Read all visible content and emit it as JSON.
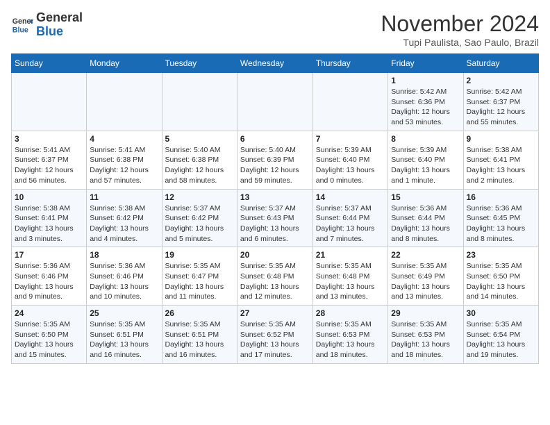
{
  "header": {
    "logo_general": "General",
    "logo_blue": "Blue",
    "title": "November 2024",
    "subtitle": "Tupi Paulista, Sao Paulo, Brazil"
  },
  "days_of_week": [
    "Sunday",
    "Monday",
    "Tuesday",
    "Wednesday",
    "Thursday",
    "Friday",
    "Saturday"
  ],
  "weeks": [
    [
      {
        "day": "",
        "info": ""
      },
      {
        "day": "",
        "info": ""
      },
      {
        "day": "",
        "info": ""
      },
      {
        "day": "",
        "info": ""
      },
      {
        "day": "",
        "info": ""
      },
      {
        "day": "1",
        "info": "Sunrise: 5:42 AM\nSunset: 6:36 PM\nDaylight: 12 hours and 53 minutes."
      },
      {
        "day": "2",
        "info": "Sunrise: 5:42 AM\nSunset: 6:37 PM\nDaylight: 12 hours and 55 minutes."
      }
    ],
    [
      {
        "day": "3",
        "info": "Sunrise: 5:41 AM\nSunset: 6:37 PM\nDaylight: 12 hours and 56 minutes."
      },
      {
        "day": "4",
        "info": "Sunrise: 5:41 AM\nSunset: 6:38 PM\nDaylight: 12 hours and 57 minutes."
      },
      {
        "day": "5",
        "info": "Sunrise: 5:40 AM\nSunset: 6:38 PM\nDaylight: 12 hours and 58 minutes."
      },
      {
        "day": "6",
        "info": "Sunrise: 5:40 AM\nSunset: 6:39 PM\nDaylight: 12 hours and 59 minutes."
      },
      {
        "day": "7",
        "info": "Sunrise: 5:39 AM\nSunset: 6:40 PM\nDaylight: 13 hours and 0 minutes."
      },
      {
        "day": "8",
        "info": "Sunrise: 5:39 AM\nSunset: 6:40 PM\nDaylight: 13 hours and 1 minute."
      },
      {
        "day": "9",
        "info": "Sunrise: 5:38 AM\nSunset: 6:41 PM\nDaylight: 13 hours and 2 minutes."
      }
    ],
    [
      {
        "day": "10",
        "info": "Sunrise: 5:38 AM\nSunset: 6:41 PM\nDaylight: 13 hours and 3 minutes."
      },
      {
        "day": "11",
        "info": "Sunrise: 5:38 AM\nSunset: 6:42 PM\nDaylight: 13 hours and 4 minutes."
      },
      {
        "day": "12",
        "info": "Sunrise: 5:37 AM\nSunset: 6:42 PM\nDaylight: 13 hours and 5 minutes."
      },
      {
        "day": "13",
        "info": "Sunrise: 5:37 AM\nSunset: 6:43 PM\nDaylight: 13 hours and 6 minutes."
      },
      {
        "day": "14",
        "info": "Sunrise: 5:37 AM\nSunset: 6:44 PM\nDaylight: 13 hours and 7 minutes."
      },
      {
        "day": "15",
        "info": "Sunrise: 5:36 AM\nSunset: 6:44 PM\nDaylight: 13 hours and 8 minutes."
      },
      {
        "day": "16",
        "info": "Sunrise: 5:36 AM\nSunset: 6:45 PM\nDaylight: 13 hours and 8 minutes."
      }
    ],
    [
      {
        "day": "17",
        "info": "Sunrise: 5:36 AM\nSunset: 6:46 PM\nDaylight: 13 hours and 9 minutes."
      },
      {
        "day": "18",
        "info": "Sunrise: 5:36 AM\nSunset: 6:46 PM\nDaylight: 13 hours and 10 minutes."
      },
      {
        "day": "19",
        "info": "Sunrise: 5:35 AM\nSunset: 6:47 PM\nDaylight: 13 hours and 11 minutes."
      },
      {
        "day": "20",
        "info": "Sunrise: 5:35 AM\nSunset: 6:48 PM\nDaylight: 13 hours and 12 minutes."
      },
      {
        "day": "21",
        "info": "Sunrise: 5:35 AM\nSunset: 6:48 PM\nDaylight: 13 hours and 13 minutes."
      },
      {
        "day": "22",
        "info": "Sunrise: 5:35 AM\nSunset: 6:49 PM\nDaylight: 13 hours and 13 minutes."
      },
      {
        "day": "23",
        "info": "Sunrise: 5:35 AM\nSunset: 6:50 PM\nDaylight: 13 hours and 14 minutes."
      }
    ],
    [
      {
        "day": "24",
        "info": "Sunrise: 5:35 AM\nSunset: 6:50 PM\nDaylight: 13 hours and 15 minutes."
      },
      {
        "day": "25",
        "info": "Sunrise: 5:35 AM\nSunset: 6:51 PM\nDaylight: 13 hours and 16 minutes."
      },
      {
        "day": "26",
        "info": "Sunrise: 5:35 AM\nSunset: 6:51 PM\nDaylight: 13 hours and 16 minutes."
      },
      {
        "day": "27",
        "info": "Sunrise: 5:35 AM\nSunset: 6:52 PM\nDaylight: 13 hours and 17 minutes."
      },
      {
        "day": "28",
        "info": "Sunrise: 5:35 AM\nSunset: 6:53 PM\nDaylight: 13 hours and 18 minutes."
      },
      {
        "day": "29",
        "info": "Sunrise: 5:35 AM\nSunset: 6:53 PM\nDaylight: 13 hours and 18 minutes."
      },
      {
        "day": "30",
        "info": "Sunrise: 5:35 AM\nSunset: 6:54 PM\nDaylight: 13 hours and 19 minutes."
      }
    ]
  ]
}
